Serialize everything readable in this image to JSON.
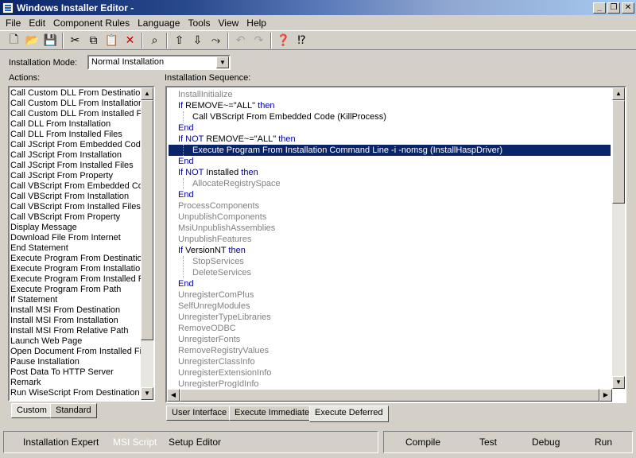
{
  "window": {
    "title": "Windows Installer Editor -"
  },
  "menu": [
    "File",
    "Edit",
    "Component Rules",
    "Language",
    "Tools",
    "View",
    "Help"
  ],
  "install_mode": {
    "label": "Installation Mode:",
    "value": "Normal Installation"
  },
  "actions_label": "Actions:",
  "actions": [
    "Call Custom DLL From Destination",
    "Call Custom DLL From Installation",
    "Call Custom DLL From Installed File",
    "Call DLL From Installation",
    "Call DLL From Installed Files",
    "Call JScript From Embedded Code",
    "Call JScript From Installation",
    "Call JScript From Installed Files",
    "Call JScript From Property",
    "Call VBScript From Embedded Code",
    "Call VBScript From Installation",
    "Call VBScript From Installed Files",
    "Call VBScript From Property",
    "Display Message",
    "Download File From Internet",
    "End Statement",
    "Execute Program From Destination",
    "Execute Program From Installation",
    "Execute Program From Installed File",
    "Execute Program From Path",
    "If Statement",
    "Install MSI From Destination",
    "Install MSI From Installation",
    "Install MSI From Relative Path",
    "Launch Web Page",
    "Open Document From Installed File",
    "Pause Installation",
    "Post Data To HTTP Server",
    "Remark",
    "Run WiseScript From Destination"
  ],
  "sequence_label": "Installation Sequence:",
  "sequence": [
    {
      "text": "InstallInitialize",
      "style": "gray",
      "indent": 0
    },
    {
      "kw": "If",
      "text": " REMOVE~=\"ALL\" ",
      "kw2": "then",
      "style": "code",
      "indent": 0
    },
    {
      "text": "Call VBScript From Embedded Code (KillProcess)",
      "style": "normal",
      "indent": 1
    },
    {
      "kw": "End",
      "style": "code",
      "indent": 0
    },
    {
      "kw": "If NOT",
      "text": " REMOVE~=\"ALL\" ",
      "kw2": "then",
      "style": "code",
      "indent": 0
    },
    {
      "text": "Execute Program From Installation Command Line -i -nomsg (InstallHaspDriver)",
      "style": "selected",
      "indent": 1
    },
    {
      "kw": "End",
      "style": "code",
      "indent": 0
    },
    {
      "kw": "If NOT",
      "text": " Installed ",
      "kw2": "then",
      "style": "code",
      "indent": 0
    },
    {
      "text": "AllocateRegistrySpace",
      "style": "gray",
      "indent": 1
    },
    {
      "kw": "End",
      "style": "code",
      "indent": 0
    },
    {
      "text": "ProcessComponents",
      "style": "gray",
      "indent": 0
    },
    {
      "text": "UnpublishComponents",
      "style": "gray",
      "indent": 0
    },
    {
      "text": "MsiUnpublishAssemblies",
      "style": "gray",
      "indent": 0
    },
    {
      "text": "UnpublishFeatures",
      "style": "gray",
      "indent": 0
    },
    {
      "kw": "If",
      "text": " VersionNT ",
      "kw2": "then",
      "style": "code",
      "indent": 0
    },
    {
      "text": "StopServices",
      "style": "gray",
      "indent": 1
    },
    {
      "text": "DeleteServices",
      "style": "gray",
      "indent": 1
    },
    {
      "kw": "End",
      "style": "code",
      "indent": 0
    },
    {
      "text": "UnregisterComPlus",
      "style": "gray",
      "indent": 0
    },
    {
      "text": "SelfUnregModules",
      "style": "gray",
      "indent": 0
    },
    {
      "text": "UnregisterTypeLibraries",
      "style": "gray",
      "indent": 0
    },
    {
      "text": "RemoveODBC",
      "style": "gray",
      "indent": 0
    },
    {
      "text": "UnregisterFonts",
      "style": "gray",
      "indent": 0
    },
    {
      "text": "RemoveRegistryValues",
      "style": "gray",
      "indent": 0
    },
    {
      "text": "UnregisterClassInfo",
      "style": "gray",
      "indent": 0
    },
    {
      "text": "UnregisterExtensionInfo",
      "style": "gray",
      "indent": 0
    },
    {
      "text": "UnregisterProgIdInfo",
      "style": "gray",
      "indent": 0
    }
  ],
  "left_tabs": [
    "Custom",
    "Standard"
  ],
  "seq_tabs": [
    "User Interface",
    "Execute Immediate",
    "Execute Deferred"
  ],
  "bottom_nav": [
    "Installation Expert",
    "MSI Script",
    "Setup Editor"
  ],
  "bottom_actions": [
    "Compile",
    "Test",
    "Debug",
    "Run"
  ],
  "colors": {
    "selection": "#0a246a",
    "keyword": "#0000a0",
    "inactive": "#808080",
    "face": "#d4d0c8"
  }
}
